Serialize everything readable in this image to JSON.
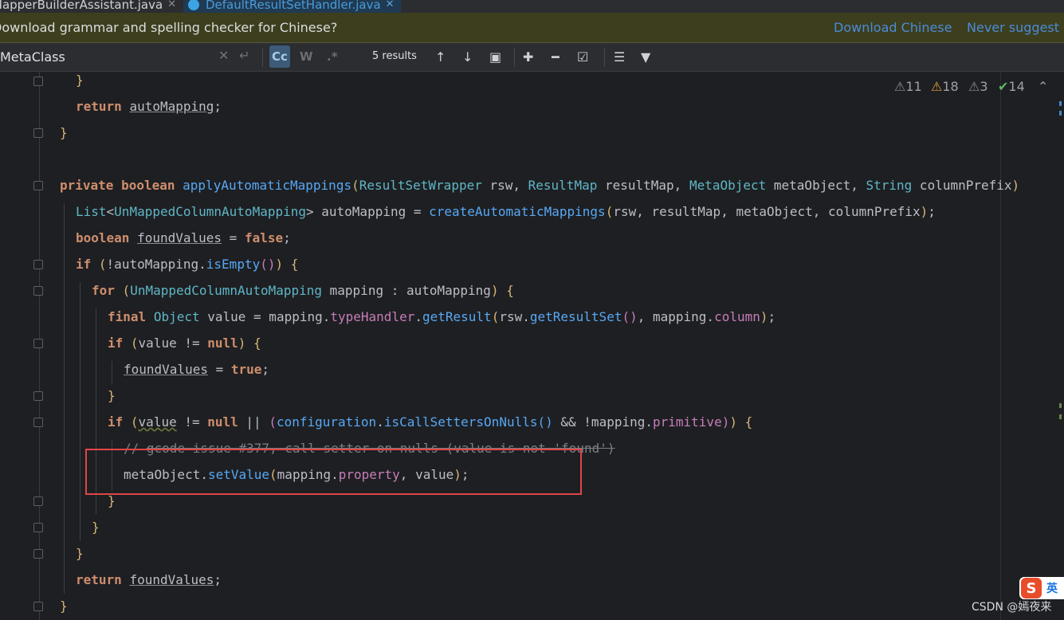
{
  "tabs": [
    {
      "label": "MapperBuilderAssistant.java",
      "active": false
    },
    {
      "label": "DefaultResultSetHandler.java",
      "active": true
    }
  ],
  "notification": {
    "message": "Download grammar and spelling checker for Chinese?",
    "download_label": "Download Chinese",
    "never_label": "Never suggest Chinese"
  },
  "find": {
    "query": "MetaClass",
    "match_case": "Cc",
    "words": "W",
    "regex": ".*",
    "results": "5 results"
  },
  "inspections": {
    "errors": "11",
    "warnings": "18",
    "weak_warnings": "3",
    "typos": "14"
  },
  "code_lines": [
    "}",
    "return autoMapping;",
    "}",
    "",
    "private boolean applyAutomaticMappings(ResultSetWrapper rsw, ResultMap resultMap, MetaObject metaObject, String columnPrefix)",
    "List<UnMappedColumnAutoMapping> autoMapping = createAutomaticMappings(rsw, resultMap, metaObject, columnPrefix);",
    "boolean foundValues = false;",
    "if (!autoMapping.isEmpty()) {",
    "for (UnMappedColumnAutoMapping mapping : autoMapping) {",
    "final Object value = mapping.typeHandler.getResult(rsw.getResultSet(), mapping.column);",
    "if (value != null) {",
    "foundValues = true;",
    "}",
    "if (value != null || (configuration.isCallSettersOnNulls() && !mapping.primitive)) {",
    "// gcode issue #377, call setter on nulls (value is not 'found')",
    "metaObject.setValue(mapping.property, value);",
    "}",
    "}",
    "}",
    "return foundValues;",
    "}"
  ],
  "ime": {
    "logo": "S",
    "mode": "英"
  },
  "watermark": "CSDN @嫣夜来",
  "colors": {
    "keyword": "#cf8e6d",
    "type": "#5fb6c7",
    "method": "#57a8f5",
    "field": "#c77dbb",
    "highlight_box": "#e04646"
  }
}
